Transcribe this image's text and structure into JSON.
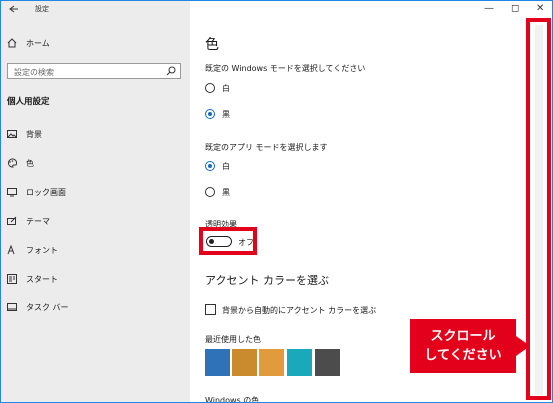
{
  "window": {
    "title": "設定",
    "back_icon": "back-arrow-icon"
  },
  "sidebar": {
    "home_label": "ホーム",
    "search_placeholder": "設定の検索",
    "section_title": "個人用設定",
    "items": [
      {
        "label": "背景",
        "icon": "picture-icon"
      },
      {
        "label": "色",
        "icon": "palette-icon"
      },
      {
        "label": "ロック画面",
        "icon": "lock-screen-icon"
      },
      {
        "label": "テーマ",
        "icon": "theme-icon"
      },
      {
        "label": "フォント",
        "icon": "font-icon"
      },
      {
        "label": "スタート",
        "icon": "start-icon"
      },
      {
        "label": "タスク バー",
        "icon": "taskbar-icon"
      }
    ]
  },
  "main": {
    "title": "色",
    "windows_mode": {
      "heading": "既定の Windows モードを選択してください",
      "options": [
        {
          "label": "白",
          "checked": false
        },
        {
          "label": "黒",
          "checked": true
        }
      ]
    },
    "app_mode": {
      "heading": "既定のアプリ モードを選択します",
      "options": [
        {
          "label": "白",
          "checked": true
        },
        {
          "label": "黒",
          "checked": false
        }
      ]
    },
    "transparency": {
      "heading": "透明効果",
      "state_label": "オフ",
      "on": false
    },
    "accent": {
      "heading": "アクセント カラーを選ぶ",
      "auto_checkbox_label": "背景から自動的にアクセント カラーを選ぶ",
      "auto_checked": false,
      "recent_heading": "最近使用した色",
      "recent_colors": [
        "#2e73b8",
        "#cc8a2e",
        "#e19b3c",
        "#1aa8bb",
        "#4c4c4c"
      ],
      "windows_colors_heading": "Windows の色"
    }
  },
  "annotation": {
    "callout_line1": "スクロール",
    "callout_line2": "してください",
    "accent_color": "#e3001b"
  }
}
